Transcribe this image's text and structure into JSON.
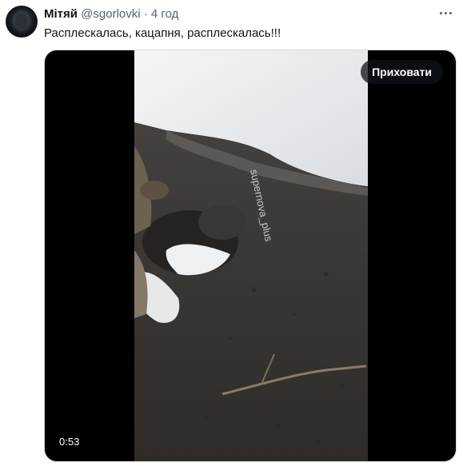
{
  "tweet": {
    "author": {
      "name": "Мітяй",
      "handle": "@sgorlovki",
      "separator": "·",
      "time": "4 год",
      "avatar_icon": "avatar-image"
    },
    "text": "Расплескалась, кацапня, расплескалась!!!",
    "more_icon": "more-dots-icon",
    "media": {
      "hide_label": "Приховати",
      "duration": "0:53",
      "watermark": "supernova_plus"
    }
  }
}
